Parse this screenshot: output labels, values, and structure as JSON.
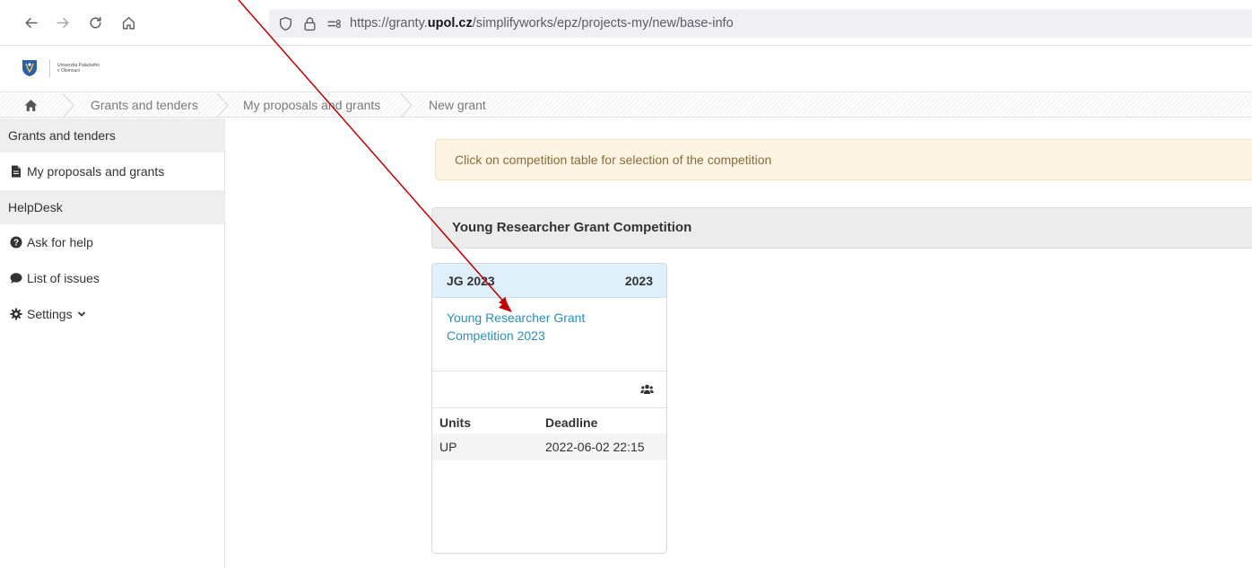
{
  "browser": {
    "url_prefix": "https://granty.",
    "url_domain": "upol.cz",
    "url_path": "/simplifyworks/epz/projects-my/new/base-info"
  },
  "header": {
    "logo_text_line1": "Univerzita Palackého",
    "logo_text_line2": "v Olomouci"
  },
  "breadcrumb": {
    "items": [
      "Grants and tenders",
      "My proposals and grants",
      "New grant"
    ]
  },
  "sidebar": {
    "section1": "Grants and tenders",
    "my_proposals": "My proposals and grants",
    "section2": "HelpDesk",
    "ask_help": "Ask for help",
    "list_issues": "List of issues",
    "settings": "Settings"
  },
  "main": {
    "alert": "Click on competition table for selection of the competition",
    "section_title": "Young Researcher Grant Competition",
    "card": {
      "code": "JG 2023",
      "year": "2023",
      "title": "Young Researcher Grant Competition 2023",
      "col_units": "Units",
      "col_deadline": "Deadline",
      "unit": "UP",
      "deadline": "2022-06-02 22:15"
    }
  },
  "colors": {
    "link": "#2a8fbd",
    "alert_bg": "#fcf3e3",
    "card_head_bg": "#dff0fa",
    "annotation_arrow": "#c00000"
  },
  "icons": {
    "back": "back-arrow-icon",
    "forward": "forward-arrow-icon",
    "reload": "reload-icon",
    "home": "home-icon",
    "shield": "shield-icon",
    "lock": "lock-icon",
    "permissions": "permissions-icon",
    "file": "file-icon",
    "question": "question-circle-icon",
    "comment": "comment-icon",
    "gear": "gear-icon",
    "chevron": "chevron-down-icon",
    "users": "users-icon"
  }
}
